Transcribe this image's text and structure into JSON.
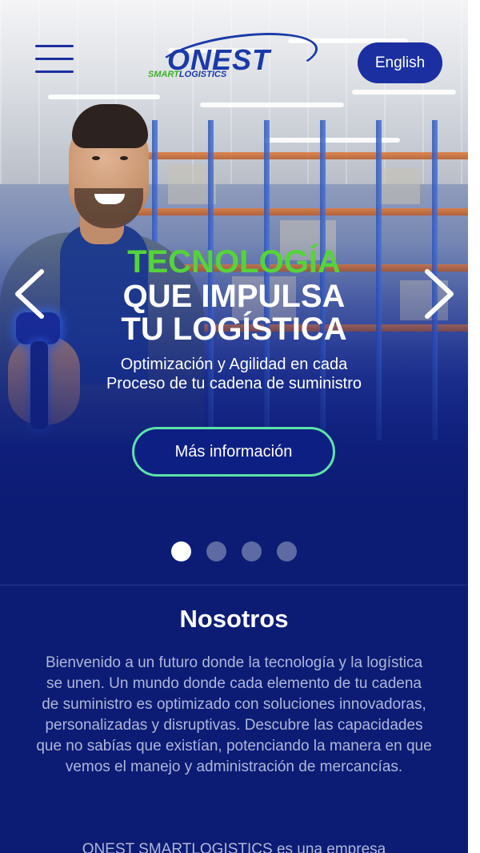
{
  "header": {
    "logo_word": "ONEST",
    "logo_smart": "SMART",
    "logo_logistics": "LOGISTICS",
    "language_button": "English",
    "menu_icon": "hamburger-menu-icon"
  },
  "hero": {
    "title_line1": "TECNOLOGÍA",
    "title_line2": "QUE IMPULSA",
    "title_line3": "TU LOGÍSTICA",
    "subtitle": "Optimización y Agilidad en cada Proceso de tu cadena de suministro",
    "cta_label": "Más información",
    "slide_count": 4,
    "active_slide": 1,
    "prev_icon": "chevron-left-icon",
    "next_icon": "chevron-right-icon",
    "colors": {
      "accent_green": "#55d43a",
      "cta_border": "#5ee2a8",
      "brand_blue": "#1b2fa0",
      "background": "#0c1c74"
    }
  },
  "about": {
    "title": "Nosotros",
    "paragraph1": "Bienvenido a un futuro donde la tecnología y la logística se unen. Un mundo donde cada elemento de tu cadena de suministro es optimizado con soluciones innovadoras, personalizadas y disruptivas. Descubre las capacidades que no sabías que existían, potenciando la manera en que vemos el manejo y administración de mercancías.",
    "paragraph2_start": "ONEST SMARTLOGISTICS es una empresa"
  }
}
